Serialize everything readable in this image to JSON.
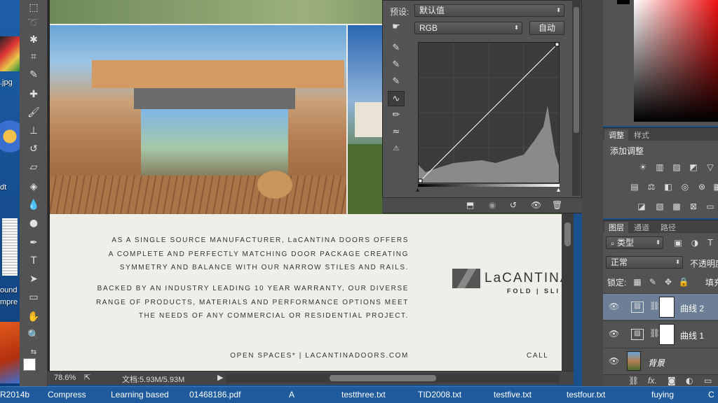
{
  "desktop": {
    "labels": [
      ".jpg",
      "dt",
      "ound",
      "mpre"
    ]
  },
  "document": {
    "paragraph1": [
      "AS A SINGLE SOURCE MANUFACTURER, LaCANTINA DOORS OFFERS",
      "A COMPLETE AND PERFECTLY MATCHING DOOR PACKAGE CREATING",
      "SYMMETRY AND BALANCE WITH OUR NARROW STILES AND RAILS."
    ],
    "paragraph2": [
      "BACKED BY AN INDUSTRY LEADING 10 YEAR WARRANTY, OUR DIVERSE",
      "RANGE OF PRODUCTS, MATERIALS AND PERFORMANCE OPTIONS MEET",
      "THE NEEDS OF ANY COMMERCIAL OR RESIDENTIAL PROJECT."
    ],
    "footer_left": "OPEN SPACES*  |  LACANTINADOORS.COM",
    "footer_right": "CALL",
    "logo_name": "LaCANTINA",
    "logo_sub": "FOLD | SLI"
  },
  "status": {
    "zoom": "78.6%",
    "doc_size": "文档:5.93M/5.93M"
  },
  "curves": {
    "preset_label": "预设:",
    "preset_value": "默认值",
    "channel": "RGB",
    "auto_button": "自动"
  },
  "adjustments": {
    "tab_adjust": "调整",
    "tab_style": "样式",
    "add_label": "添加调整"
  },
  "layers": {
    "tab_layers": "图层",
    "tab_channels": "通道",
    "tab_paths": "路径",
    "filter_kind": "类型",
    "blend_mode": "正常",
    "opacity_label": "不透明度",
    "lock_label": "锁定:",
    "fill_label": "填充",
    "items": [
      {
        "name": "曲线 2"
      },
      {
        "name": "曲线 1"
      },
      {
        "name": "背景"
      }
    ]
  },
  "taskbar": {
    "items": [
      "R2014b",
      "Compress",
      "Learning based",
      "01468186.pdf",
      "A",
      "testthree.txt",
      "TID2008.txt",
      "testfive.txt",
      "testfour.txt",
      "fuying",
      "C"
    ]
  },
  "colors": {
    "panel": "#535353",
    "active_layer": "#6d7f96",
    "taskbar": "#1e5a9c"
  }
}
